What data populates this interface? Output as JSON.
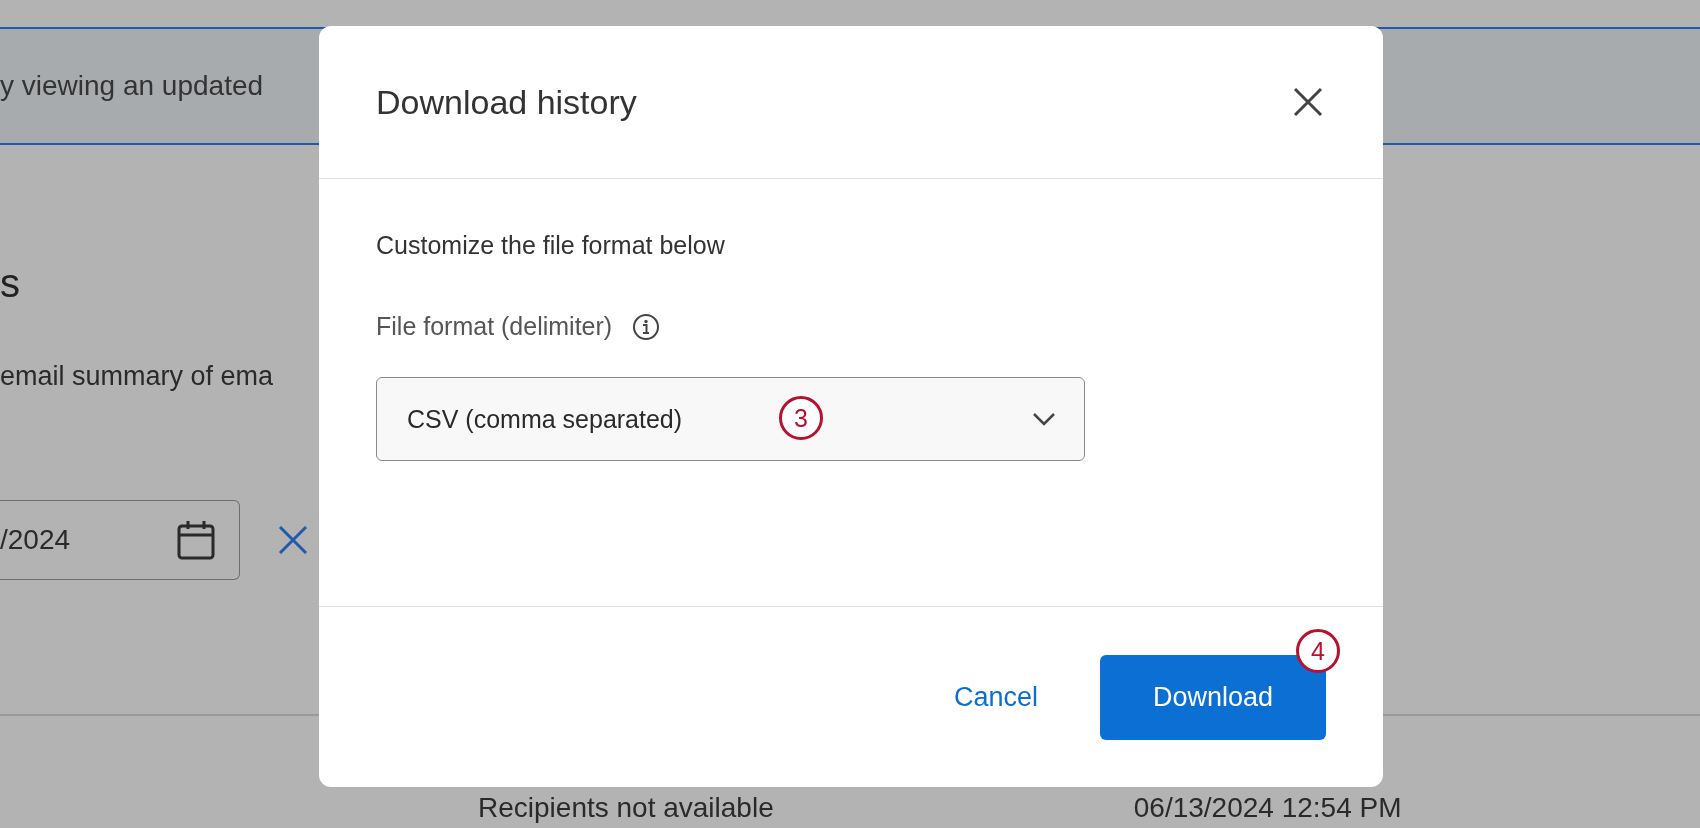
{
  "background": {
    "banner": "y viewing an updated",
    "heading": "s",
    "description": "email summary of ema",
    "date_field": {
      "value": "/2024"
    },
    "row": {
      "recipients": "Recipients not available",
      "date": "06/13/2024 12:54 PM"
    }
  },
  "dialog": {
    "title": "Download history",
    "intro": "Customize the file format below",
    "field_label": "File format (delimiter)",
    "select": {
      "value": "CSV (comma separated)",
      "marker": "3"
    },
    "buttons": [
      {
        "label": "Cancel",
        "kind": "link"
      },
      {
        "label": "Download",
        "kind": "primary",
        "marker": "4"
      }
    ]
  }
}
